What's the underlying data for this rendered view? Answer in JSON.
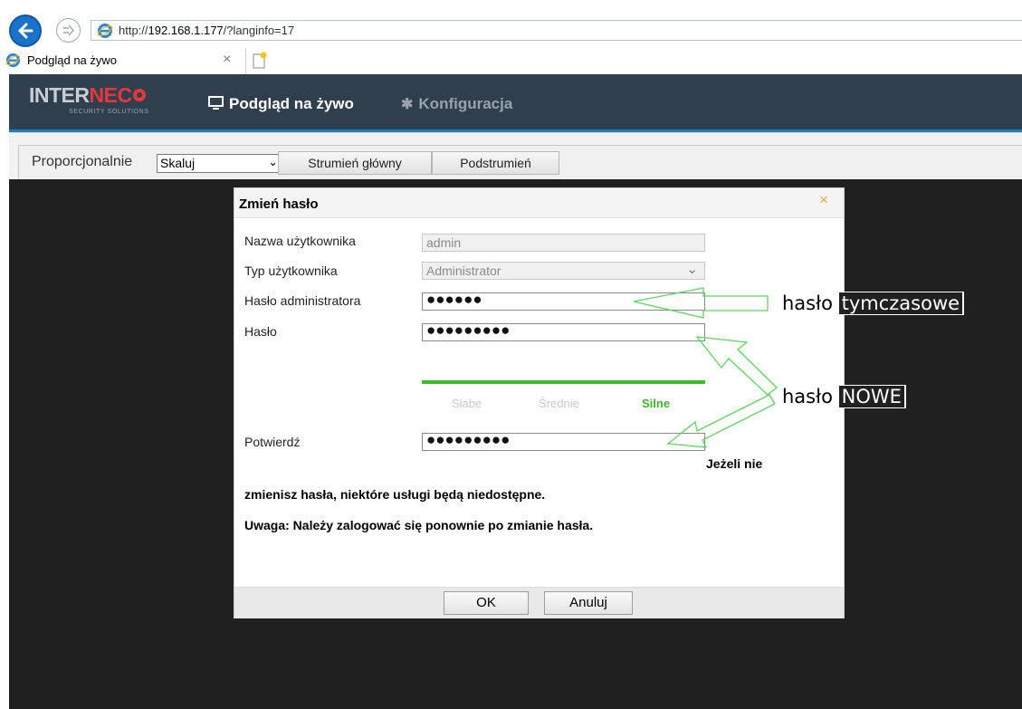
{
  "browser": {
    "url_prefix": "http://",
    "url_host": "192.168.1.177",
    "url_path": "/?langinfo=17",
    "tab_title": "Podgląd na żywo",
    "tab_close": "×"
  },
  "app": {
    "logo_main_left": "INTER",
    "logo_main_right": "NEC",
    "logo_sub": "SECURITY SOLUTIONS",
    "nav": {
      "live_label": "Podgląd na żywo",
      "config_label": "Konfiguracja"
    }
  },
  "toolbar": {
    "proportion_label": "Proporcjonalnie",
    "scale_value": "Skaluj",
    "main_stream_label": "Strumień główny",
    "sub_stream_label": "Podstrumień"
  },
  "dialog": {
    "title": "Zmień hasło",
    "close": "×",
    "fields": {
      "username_label": "Nazwa użytkownika",
      "username_value": "admin",
      "usertype_label": "Typ użytkownika",
      "usertype_value": "Administrator",
      "admin_password_label": "Hasło administratora",
      "admin_password_mask": "●●●●●●",
      "password_label": "Hasło",
      "password_mask": "●●●●●●●●●",
      "confirm_label": "Potwierdź",
      "confirm_mask": "●●●●●●●●●"
    },
    "strength": {
      "weak": "Słabe",
      "medium": "Średnie",
      "strong": "Silne",
      "level": "strong"
    },
    "warning_line1": "Jeżeli nie",
    "warning_line2": "zmienisz hasła, niektóre usługi będą niedostępne.",
    "warning_line3": "Uwaga: Należy zalogować się ponownie po zmianie hasła.",
    "ok_label": "OK",
    "cancel_label": "Anuluj"
  },
  "annotations": {
    "temp_word1": "hasło",
    "temp_word2": "tymczasowe",
    "new_word1": "hasło",
    "new_word2": "NOWE",
    "arrow_color": "#5fd35f"
  },
  "colors": {
    "header_bg": "#2f3f4e",
    "accent_line": "#1c7ec3",
    "strength_green": "#3fbc2b",
    "video_bg": "#202020"
  }
}
